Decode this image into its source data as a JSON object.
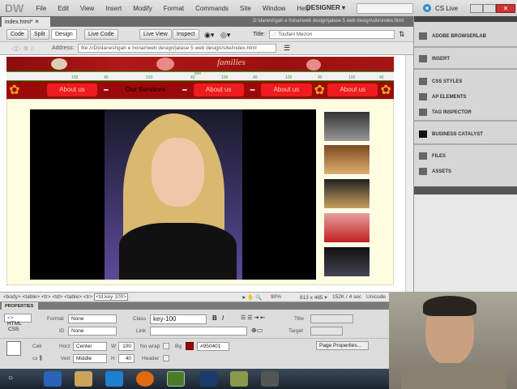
{
  "app": {
    "logo": "DW",
    "menus": [
      "File",
      "Edit",
      "View",
      "Insert",
      "Modify",
      "Format",
      "Commands",
      "Site",
      "Window",
      "Help"
    ],
    "workspace": "DESIGNER ▾",
    "cs_live": "CS Live"
  },
  "document": {
    "tab": "index.html*",
    "path": "D:\\daneshgah e honar\\web design\\jalase 5 web design\\site\\index.html"
  },
  "toolbar": {
    "code": "Code",
    "split": "Split",
    "design": "Design",
    "live_code": "Live Code",
    "live_view": "Live View",
    "inspect": "Inspect",
    "title_label": "Title:",
    "title_value": ".:: Toufani Mezon"
  },
  "address": {
    "label": "Address:",
    "value": "file:///D|/daneshgah e honar/web design/jalase 5 web design/site/index.html"
  },
  "page": {
    "banner_text": "families",
    "ruler": [
      "850",
      "100",
      "40",
      "120",
      "40",
      "100",
      "40",
      "120",
      "40",
      "100",
      "40"
    ],
    "nav": [
      "About us",
      "Our Services",
      "About us",
      "About us",
      "About us"
    ]
  },
  "status": {
    "tags": "<body> <table> <tr> <td> <table> <tr>",
    "selected_tag": "<td.key-100>",
    "zoom": "90%",
    "size": "813 x 465 ▾",
    "download": "152K / 4 sec",
    "encoding": "Unicode"
  },
  "properties": {
    "title": "PROPERTIES",
    "html": "HTML",
    "css": "CSS",
    "format_label": "Format",
    "format": "None",
    "id_label": "ID",
    "id": "None",
    "class_label": "Class",
    "class": "key-100",
    "link_label": "Link",
    "title_label": "Title",
    "target_label": "Target",
    "cell": "Cell",
    "horz_label": "Horz",
    "horz": "Center",
    "vert_label": "Vert",
    "vert": "Middle",
    "w_label": "W",
    "w": "100",
    "h_label": "H",
    "h": "40",
    "nowrap": "No wrap",
    "header": "Header",
    "bg_label": "Bg",
    "bg": "#950401",
    "page_props": "Page Properties..."
  },
  "panels": [
    {
      "label": "ADOBE BROWSERLAB"
    },
    {
      "label": "INSERT"
    },
    {
      "label": "CSS STYLES"
    },
    {
      "label": "AP ELEMENTS"
    },
    {
      "label": "TAG INSPECTOR"
    },
    {
      "label": "BUSINESS CATALYST"
    },
    {
      "label": "FILES"
    },
    {
      "label": "ASSETS"
    }
  ]
}
